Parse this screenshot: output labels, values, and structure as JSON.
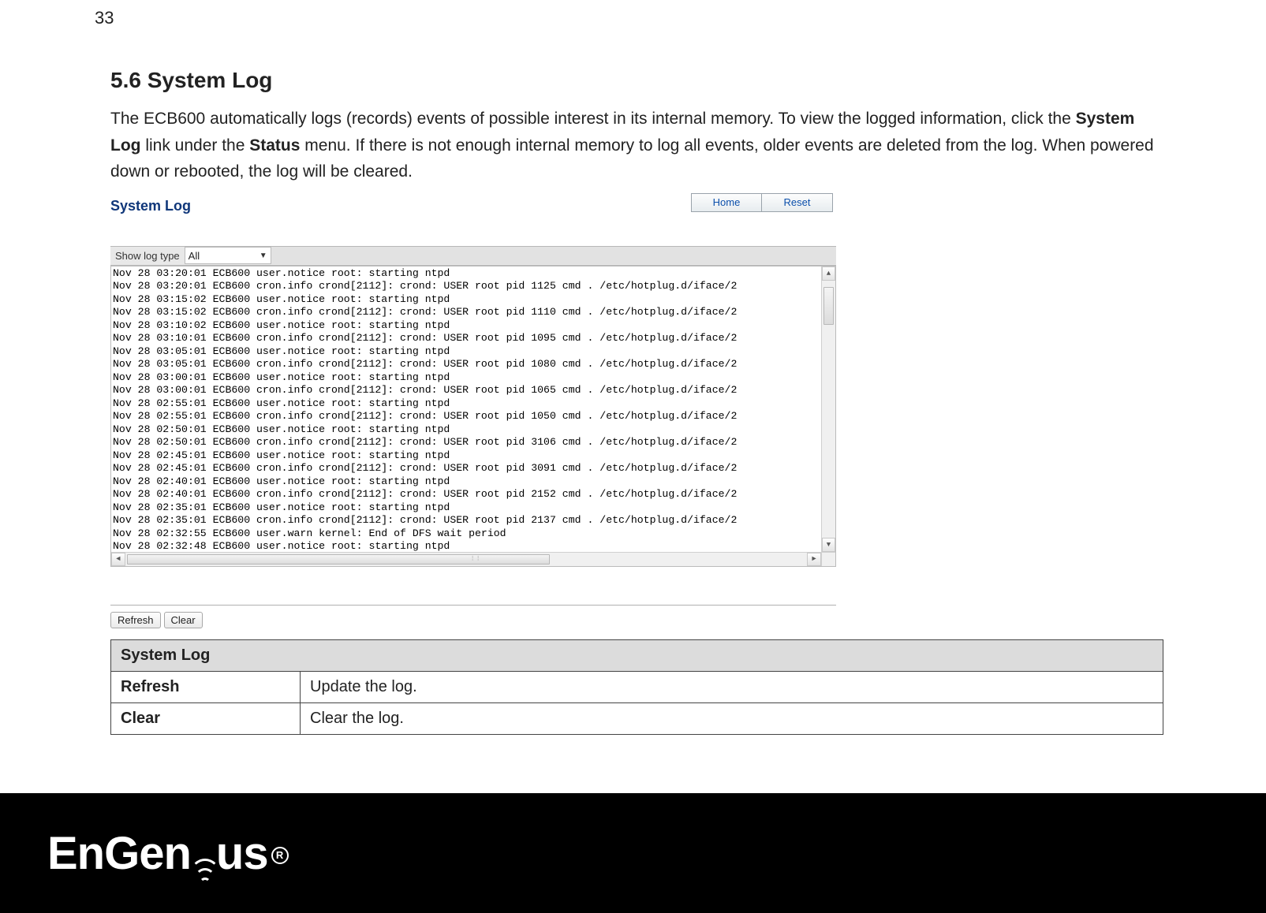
{
  "page_number": "33",
  "heading": "5.6   System Log",
  "paragraph_parts": {
    "p1a": "The ECB600 automatically logs (records) events of possible interest in its internal memory. To view the logged information, click the ",
    "p1b": "System Log",
    "p1c": " link under the ",
    "p1d": "Status",
    "p1e": " menu. If there is not enough internal memory to log all events, older events are deleted from the log. When powered down or rebooted, the log will be cleared."
  },
  "screenshot": {
    "title": "System Log",
    "home_btn": "Home",
    "reset_btn": "Reset",
    "filter_label": "Show log type",
    "filter_value": "All",
    "refresh_btn": "Refresh",
    "clear_btn": "Clear",
    "log_lines": [
      "Nov 28 03:20:01 ECB600 user.notice root: starting ntpd",
      "Nov 28 03:20:01 ECB600 cron.info crond[2112]: crond: USER root pid 1125 cmd . /etc/hotplug.d/iface/2",
      "Nov 28 03:15:02 ECB600 user.notice root: starting ntpd",
      "Nov 28 03:15:02 ECB600 cron.info crond[2112]: crond: USER root pid 1110 cmd . /etc/hotplug.d/iface/2",
      "Nov 28 03:10:02 ECB600 user.notice root: starting ntpd",
      "Nov 28 03:10:01 ECB600 cron.info crond[2112]: crond: USER root pid 1095 cmd . /etc/hotplug.d/iface/2",
      "Nov 28 03:05:01 ECB600 user.notice root: starting ntpd",
      "Nov 28 03:05:01 ECB600 cron.info crond[2112]: crond: USER root pid 1080 cmd . /etc/hotplug.d/iface/2",
      "Nov 28 03:00:01 ECB600 user.notice root: starting ntpd",
      "Nov 28 03:00:01 ECB600 cron.info crond[2112]: crond: USER root pid 1065 cmd . /etc/hotplug.d/iface/2",
      "Nov 28 02:55:01 ECB600 user.notice root: starting ntpd",
      "Nov 28 02:55:01 ECB600 cron.info crond[2112]: crond: USER root pid 1050 cmd . /etc/hotplug.d/iface/2",
      "Nov 28 02:50:01 ECB600 user.notice root: starting ntpd",
      "Nov 28 02:50:01 ECB600 cron.info crond[2112]: crond: USER root pid 3106 cmd . /etc/hotplug.d/iface/2",
      "Nov 28 02:45:01 ECB600 user.notice root: starting ntpd",
      "Nov 28 02:45:01 ECB600 cron.info crond[2112]: crond: USER root pid 3091 cmd . /etc/hotplug.d/iface/2",
      "Nov 28 02:40:01 ECB600 user.notice root: starting ntpd",
      "Nov 28 02:40:01 ECB600 cron.info crond[2112]: crond: USER root pid 2152 cmd . /etc/hotplug.d/iface/2",
      "Nov 28 02:35:01 ECB600 user.notice root: starting ntpd",
      "Nov 28 02:35:01 ECB600 cron.info crond[2112]: crond: USER root pid 2137 cmd . /etc/hotplug.d/iface/2",
      "Nov 28 02:32:55 ECB600 user.warn kernel: End of DFS wait period",
      "Nov 28 02:32:48 ECB600 user.notice root: starting ntpd"
    ]
  },
  "table": {
    "header": "System Log",
    "rows": [
      {
        "key": "Refresh",
        "desc": "Update the log."
      },
      {
        "key": "Clear",
        "desc": "Clear the log."
      }
    ]
  },
  "footer": {
    "brand_prefix": "EnGen",
    "brand_suffix": "us",
    "reg": "R"
  }
}
